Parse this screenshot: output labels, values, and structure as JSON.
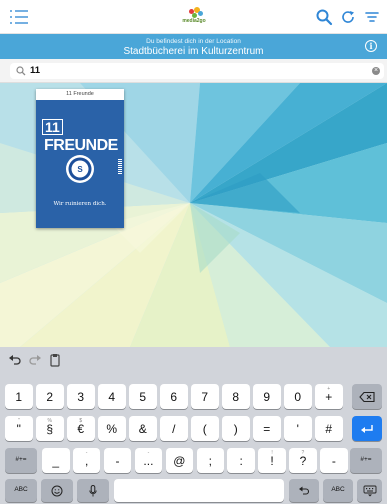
{
  "header": {
    "logo_text": "media2go"
  },
  "banner": {
    "line1": "Du befindest dich in der Location",
    "line2": "Stadtbücherei im Kulturzentrum"
  },
  "search": {
    "value": "11"
  },
  "results": [
    {
      "top_label": "11 Freunde",
      "brand_number": "11",
      "brand_word": "FREUNDE",
      "slogan": "Wir ruinieren dich."
    }
  ],
  "keyboard": {
    "row1": [
      {
        "main": "1",
        "hint": ""
      },
      {
        "main": "2",
        "hint": ""
      },
      {
        "main": "3",
        "hint": ""
      },
      {
        "main": "4",
        "hint": ""
      },
      {
        "main": "5",
        "hint": ""
      },
      {
        "main": "6",
        "hint": ""
      },
      {
        "main": "7",
        "hint": ""
      },
      {
        "main": "8",
        "hint": ""
      },
      {
        "main": "9",
        "hint": ""
      },
      {
        "main": "0",
        "hint": ""
      },
      {
        "main": "+",
        "hint": "+"
      }
    ],
    "row2": [
      {
        "main": "\"",
        "hint": "\""
      },
      {
        "main": "§",
        "hint": "%"
      },
      {
        "main": "€",
        "hint": "$"
      },
      {
        "main": "%",
        "hint": ""
      },
      {
        "main": "&",
        "hint": ""
      },
      {
        "main": "/",
        "hint": ""
      },
      {
        "main": "(",
        "hint": ""
      },
      {
        "main": ")",
        "hint": ""
      },
      {
        "main": "=",
        "hint": ""
      },
      {
        "main": "'",
        "hint": ""
      },
      {
        "main": "#",
        "hint": ""
      }
    ],
    "row3": [
      {
        "main": "_",
        "hint": ""
      },
      {
        "main": ",",
        "hint": "-"
      },
      {
        "main": "-",
        "hint": ""
      },
      {
        "main": "...",
        "hint": "-"
      },
      {
        "main": "@",
        "hint": ""
      },
      {
        "main": ";",
        "hint": ""
      },
      {
        "main": ":",
        "hint": ""
      },
      {
        "main": "!",
        "hint": "!"
      },
      {
        "main": "?",
        "hint": "?"
      },
      {
        "main": "-",
        "hint": ""
      }
    ],
    "shift_left": "#+=",
    "shift_right": "#+=",
    "abc_left": "ABC",
    "abc_right": "ABC"
  },
  "colors": {
    "banner": "#4aa6d8",
    "accent": "#1e7cf0",
    "magazine": "#2a62a8"
  }
}
